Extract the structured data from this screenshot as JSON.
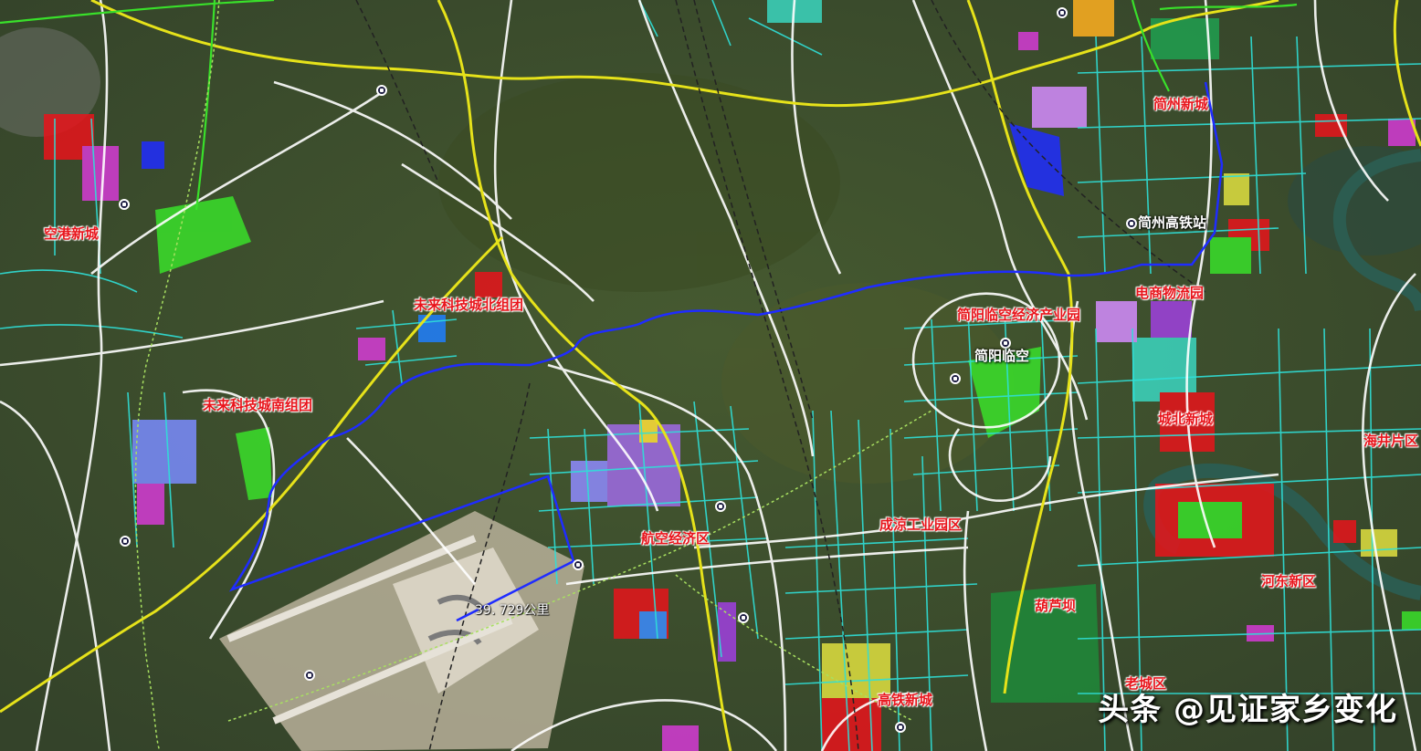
{
  "map": {
    "labels": {
      "konggang_xincheng": "空港新城",
      "weilai_north": "未来科技城北组团",
      "weilai_south": "未来科技城南组团",
      "hangkong_jingji": "航空经济区",
      "chengliang_gongye": "成涼工业园区",
      "gaotie_xincheng": "高铁新城",
      "huluba": "葫芦坝",
      "laocheng": "老城区",
      "hedong": "河东新区",
      "haijing": "海井片区",
      "chengbei": "城北新城",
      "dianshang_wuliu": "电商物流园",
      "jianyang_linkong_park": "简阳临空经济产业园",
      "jianzhou_xincheng": "简州新城"
    },
    "white_labels": {
      "jianzhou_station": "简州高铁站",
      "jianyang_linkong": "简阳临空"
    },
    "measure": {
      "distance": "39. 729公里"
    },
    "watermark": "头条 @见证家乡变化",
    "colors": {
      "route": "#1f2cff",
      "expressway": "#e6e21a",
      "road": "#ffffff",
      "planned_road": "#2fe0d8",
      "district_red": "#e8141b"
    }
  }
}
